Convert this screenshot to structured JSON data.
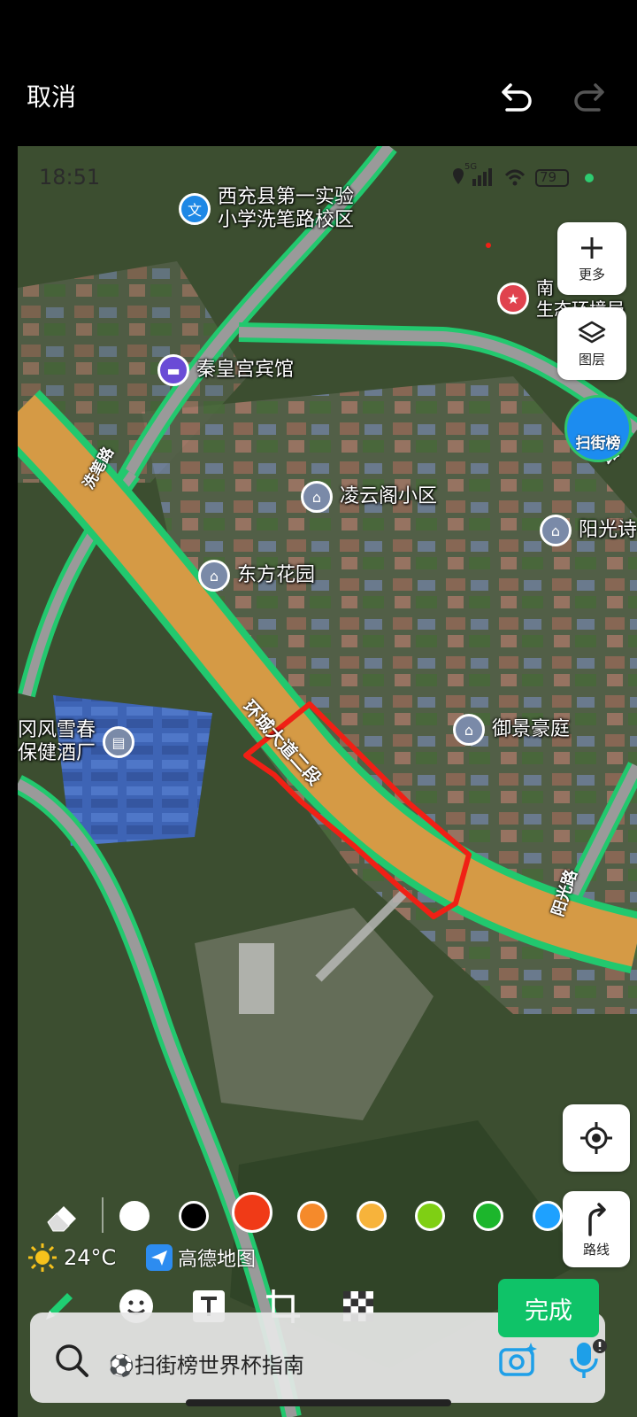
{
  "toolbar": {
    "cancel_label": "取消"
  },
  "status_bar": {
    "time": "18:51",
    "network": "5G",
    "battery": "79"
  },
  "map": {
    "pois": [
      {
        "label": "西充县第一实验\n小学洗笔路校区",
        "icon": "school-icon",
        "color": "#1e88e5"
      },
      {
        "label": "秦皇宫宾馆",
        "icon": "hotel-icon",
        "color": "#6a4bd6"
      },
      {
        "label": "凌云阁小区",
        "icon": "residential-icon",
        "color": "#7a8aa8"
      },
      {
        "label": "东方花园",
        "icon": "residential-icon",
        "color": "#7a8aa8"
      },
      {
        "label": "阳光诗",
        "icon": "residential-icon",
        "color": "#7a8aa8"
      },
      {
        "label": "御景豪庭",
        "icon": "residential-icon",
        "color": "#7a8aa8"
      },
      {
        "label": "冈风雪春\n保健酒厂",
        "icon": "factory-icon",
        "color": "#7a8aa8"
      },
      {
        "label": "南\n生态环境局",
        "icon": "gov-icon",
        "color": "#e0424e"
      }
    ],
    "road_labels": [
      "洗笔路",
      "环城大道二段",
      "阳光路",
      "路"
    ],
    "buttons": {
      "more": "更多",
      "layers": "图层",
      "route": "路线"
    },
    "scan_badge": "扫街榜",
    "weather": "24°C",
    "brand": "高德地图"
  },
  "pen_colors": [
    "#ffffff",
    "#000000",
    "#f03a17",
    "#f58a2b",
    "#f7b33b",
    "#7fcf14",
    "#1cb62c",
    "#1ea1ff"
  ],
  "selected_color_index": 2,
  "search": {
    "placeholder": "⚽扫街榜世界杯指南"
  },
  "done_label": "完成"
}
